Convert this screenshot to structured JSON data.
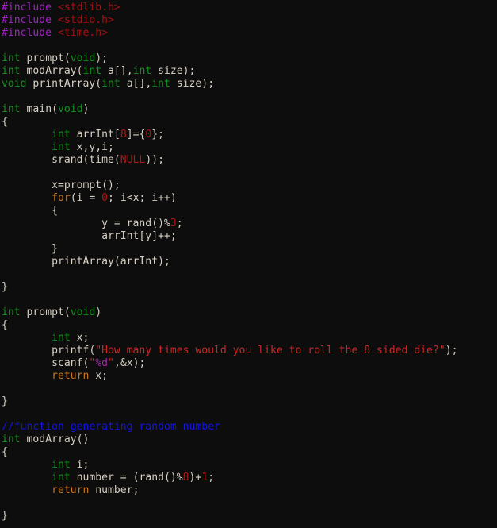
{
  "editor": {
    "language": "C",
    "background_color": "#0d0d0d",
    "default_text_color": "#d6cfc2",
    "syntax_colors": {
      "preprocessor": "#a222c6",
      "header_name": "#9e1414",
      "type": "#12911f",
      "keyword": "#c7761f",
      "string": "#c62828",
      "format_specifier": "#a626a6",
      "number": "#b01515",
      "comment": "#1414e0",
      "plain": "#d6cfc2"
    }
  },
  "code": {
    "full_text": "#include <stdlib.h>\n#include <stdio.h>\n#include <time.h>\n\nint prompt(void);\nint modArray(int a[],int size);\nvoid printArray(int a[],int size);\n\nint main(void)\n{\n        int arrInt[8]={0};\n        int x,y,i;\n        srand(time(NULL));\n\n        x=prompt();\n        for(i = 0; i<x; i++)\n        {\n                y = rand()%3;\n                arrInt[y]++;\n        }\n        printArray(arrInt);\n\n}\n\nint prompt(void)\n{\n        int x;\n        printf(\"How many times would you like to roll the 8 sided die?\");\n        scanf(\"%d\",&x);\n        return x;\n\n}\n\n//function generating random number\nint modArray()\n{\n        int i;\n        int number = (rand()%8)+1;\n        return number;\n\n}",
    "lines": [
      {
        "n": 1,
        "tokens": [
          {
            "t": "#include",
            "c": "pre"
          },
          {
            "t": " ",
            "c": "pln"
          },
          {
            "t": "<stdlib.h>",
            "c": "hdr"
          }
        ]
      },
      {
        "n": 2,
        "tokens": [
          {
            "t": "#include",
            "c": "pre"
          },
          {
            "t": " ",
            "c": "pln"
          },
          {
            "t": "<stdio.h>",
            "c": "hdr"
          }
        ]
      },
      {
        "n": 3,
        "tokens": [
          {
            "t": "#include",
            "c": "pre"
          },
          {
            "t": " ",
            "c": "pln"
          },
          {
            "t": "<time.h>",
            "c": "hdr"
          }
        ]
      },
      {
        "n": 4,
        "tokens": []
      },
      {
        "n": 5,
        "tokens": [
          {
            "t": "int",
            "c": "typ"
          },
          {
            "t": " prompt(",
            "c": "pln"
          },
          {
            "t": "void",
            "c": "typ"
          },
          {
            "t": ");",
            "c": "pln"
          }
        ]
      },
      {
        "n": 6,
        "tokens": [
          {
            "t": "int",
            "c": "typ"
          },
          {
            "t": " modArray(",
            "c": "pln"
          },
          {
            "t": "int",
            "c": "typ"
          },
          {
            "t": " a[],",
            "c": "pln"
          },
          {
            "t": "int",
            "c": "typ"
          },
          {
            "t": " size);",
            "c": "pln"
          }
        ]
      },
      {
        "n": 7,
        "tokens": [
          {
            "t": "void",
            "c": "typ"
          },
          {
            "t": " printArray(",
            "c": "pln"
          },
          {
            "t": "int",
            "c": "typ"
          },
          {
            "t": " a[],",
            "c": "pln"
          },
          {
            "t": "int",
            "c": "typ"
          },
          {
            "t": " size);",
            "c": "pln"
          }
        ]
      },
      {
        "n": 8,
        "tokens": []
      },
      {
        "n": 9,
        "tokens": [
          {
            "t": "int",
            "c": "typ"
          },
          {
            "t": " main(",
            "c": "pln"
          },
          {
            "t": "void",
            "c": "typ"
          },
          {
            "t": ")",
            "c": "pln"
          }
        ]
      },
      {
        "n": 10,
        "tokens": [
          {
            "t": "{",
            "c": "pln"
          }
        ]
      },
      {
        "n": 11,
        "tokens": [
          {
            "t": "        ",
            "c": "pln"
          },
          {
            "t": "int",
            "c": "typ"
          },
          {
            "t": " arrInt[",
            "c": "pln"
          },
          {
            "t": "8",
            "c": "num"
          },
          {
            "t": "]={",
            "c": "pln"
          },
          {
            "t": "0",
            "c": "num"
          },
          {
            "t": "};",
            "c": "pln"
          }
        ]
      },
      {
        "n": 12,
        "tokens": [
          {
            "t": "        ",
            "c": "pln"
          },
          {
            "t": "int",
            "c": "typ"
          },
          {
            "t": " x,y,i;",
            "c": "pln"
          }
        ]
      },
      {
        "n": 13,
        "tokens": [
          {
            "t": "        srand(time(",
            "c": "pln"
          },
          {
            "t": "NULL",
            "c": "num"
          },
          {
            "t": "));",
            "c": "pln"
          }
        ]
      },
      {
        "n": 14,
        "tokens": []
      },
      {
        "n": 15,
        "tokens": [
          {
            "t": "        x=prompt();",
            "c": "pln"
          }
        ]
      },
      {
        "n": 16,
        "tokens": [
          {
            "t": "        ",
            "c": "pln"
          },
          {
            "t": "for",
            "c": "kw"
          },
          {
            "t": "(i = ",
            "c": "pln"
          },
          {
            "t": "0",
            "c": "num"
          },
          {
            "t": "; i<x; i++)",
            "c": "pln"
          }
        ]
      },
      {
        "n": 17,
        "tokens": [
          {
            "t": "        {",
            "c": "pln"
          }
        ]
      },
      {
        "n": 18,
        "tokens": [
          {
            "t": "                y = rand()%",
            "c": "pln"
          },
          {
            "t": "3",
            "c": "num"
          },
          {
            "t": ";",
            "c": "pln"
          }
        ]
      },
      {
        "n": 19,
        "tokens": [
          {
            "t": "                arrInt[y]++;",
            "c": "pln"
          }
        ]
      },
      {
        "n": 20,
        "tokens": [
          {
            "t": "        }",
            "c": "pln"
          }
        ]
      },
      {
        "n": 21,
        "tokens": [
          {
            "t": "        printArray(arrInt);",
            "c": "pln"
          }
        ]
      },
      {
        "n": 22,
        "tokens": []
      },
      {
        "n": 23,
        "tokens": [
          {
            "t": "}",
            "c": "pln"
          }
        ]
      },
      {
        "n": 24,
        "tokens": []
      },
      {
        "n": 25,
        "tokens": [
          {
            "t": "int",
            "c": "typ"
          },
          {
            "t": " prompt(",
            "c": "pln"
          },
          {
            "t": "void",
            "c": "typ"
          },
          {
            "t": ")",
            "c": "pln"
          }
        ]
      },
      {
        "n": 26,
        "tokens": [
          {
            "t": "{",
            "c": "pln"
          }
        ]
      },
      {
        "n": 27,
        "tokens": [
          {
            "t": "        ",
            "c": "pln"
          },
          {
            "t": "int",
            "c": "typ"
          },
          {
            "t": " x;",
            "c": "pln"
          }
        ]
      },
      {
        "n": 28,
        "tokens": [
          {
            "t": "        printf(",
            "c": "pln"
          },
          {
            "t": "\"How many times would you like to roll the 8 sided die?\"",
            "c": "str"
          },
          {
            "t": ");",
            "c": "pln"
          }
        ]
      },
      {
        "n": 29,
        "tokens": [
          {
            "t": "        scanf(",
            "c": "pln"
          },
          {
            "t": "\"",
            "c": "str"
          },
          {
            "t": "%d",
            "c": "fmt"
          },
          {
            "t": "\"",
            "c": "str"
          },
          {
            "t": ",&x);",
            "c": "pln"
          }
        ]
      },
      {
        "n": 30,
        "tokens": [
          {
            "t": "        ",
            "c": "pln"
          },
          {
            "t": "return",
            "c": "kw"
          },
          {
            "t": " x;",
            "c": "pln"
          }
        ]
      },
      {
        "n": 31,
        "tokens": []
      },
      {
        "n": 32,
        "tokens": [
          {
            "t": "}",
            "c": "pln"
          }
        ]
      },
      {
        "n": 33,
        "tokens": []
      },
      {
        "n": 34,
        "tokens": [
          {
            "t": "//function generating random number",
            "c": "cmt"
          }
        ]
      },
      {
        "n": 35,
        "tokens": [
          {
            "t": "int",
            "c": "typ"
          },
          {
            "t": " modArray()",
            "c": "pln"
          }
        ]
      },
      {
        "n": 36,
        "tokens": [
          {
            "t": "{",
            "c": "pln"
          }
        ]
      },
      {
        "n": 37,
        "tokens": [
          {
            "t": "        ",
            "c": "pln"
          },
          {
            "t": "int",
            "c": "typ"
          },
          {
            "t": " i;",
            "c": "pln"
          }
        ]
      },
      {
        "n": 38,
        "tokens": [
          {
            "t": "        ",
            "c": "pln"
          },
          {
            "t": "int",
            "c": "typ"
          },
          {
            "t": " number = (rand()%",
            "c": "pln"
          },
          {
            "t": "8",
            "c": "num"
          },
          {
            "t": ")+",
            "c": "pln"
          },
          {
            "t": "1",
            "c": "num"
          },
          {
            "t": ";",
            "c": "pln"
          }
        ]
      },
      {
        "n": 39,
        "tokens": [
          {
            "t": "        ",
            "c": "pln"
          },
          {
            "t": "return",
            "c": "kw"
          },
          {
            "t": " number;",
            "c": "pln"
          }
        ]
      },
      {
        "n": 40,
        "tokens": []
      },
      {
        "n": 41,
        "tokens": [
          {
            "t": "}",
            "c": "pln"
          }
        ]
      }
    ]
  }
}
